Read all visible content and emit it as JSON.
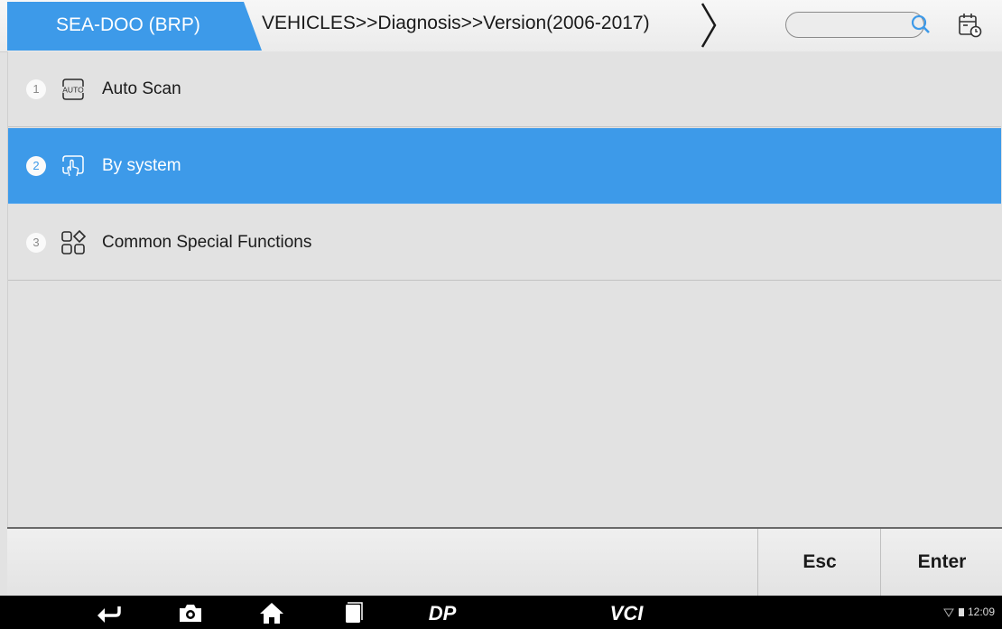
{
  "header": {
    "brand": "SEA-DOO (BRP)",
    "breadcrumb": "VEHICLES>>Diagnosis>>Version(2006-2017)",
    "search_placeholder": "",
    "accent_color": "#3d9ae9"
  },
  "menu": {
    "items": [
      {
        "number": "1",
        "label": "Auto Scan",
        "icon": "auto-icon",
        "selected": false
      },
      {
        "number": "2",
        "label": "By system",
        "icon": "touch-hand-icon",
        "selected": true
      },
      {
        "number": "3",
        "label": "Common Special Functions",
        "icon": "grid-diamond-icon",
        "selected": false
      }
    ]
  },
  "actions": {
    "esc": "Esc",
    "enter": "Enter"
  },
  "navbar": {
    "icons": [
      "back-icon",
      "camera-icon",
      "home-icon",
      "recent-apps-icon",
      "dp-icon",
      "vci-icon"
    ],
    "dp_label": "DP",
    "vci_label": "VCI",
    "time": "12:09"
  }
}
